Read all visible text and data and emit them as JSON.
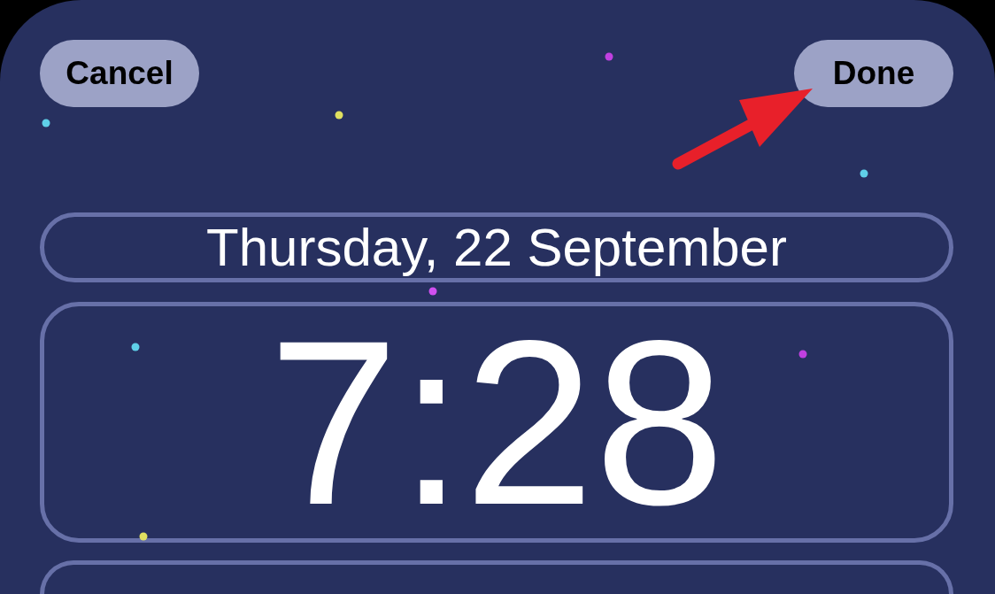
{
  "top_bar": {
    "cancel_button": "Cancel",
    "done_button": "Done"
  },
  "date": "Thursday, 22 September",
  "time": "7:28"
}
